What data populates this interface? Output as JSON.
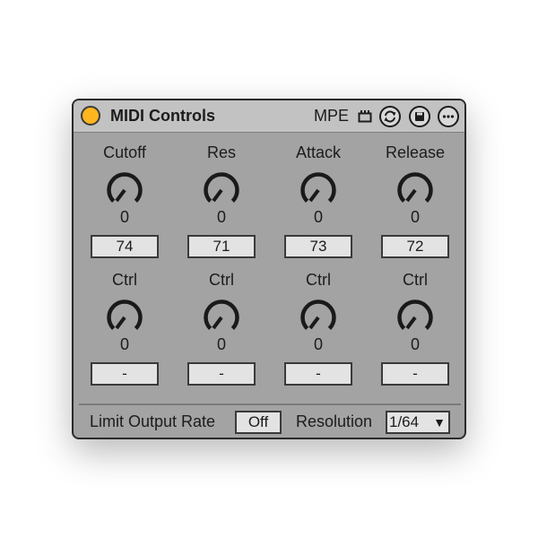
{
  "device": {
    "title": "MIDI Controls",
    "mpe_label": "MPE",
    "power_color": "#ffb51e",
    "icons": [
      "power-icon",
      "mpe-plug-icon",
      "sync-icon",
      "save-icon",
      "more-icon"
    ]
  },
  "controls": [
    {
      "label": "Cutoff",
      "value": "0",
      "cc": "74"
    },
    {
      "label": "Res",
      "value": "0",
      "cc": "71"
    },
    {
      "label": "Attack",
      "value": "0",
      "cc": "73"
    },
    {
      "label": "Release",
      "value": "0",
      "cc": "72"
    },
    {
      "label": "Ctrl",
      "value": "0",
      "cc": "-"
    },
    {
      "label": "Ctrl",
      "value": "0",
      "cc": "-"
    },
    {
      "label": "Ctrl",
      "value": "0",
      "cc": "-"
    },
    {
      "label": "Ctrl",
      "value": "0",
      "cc": "-"
    }
  ],
  "footer": {
    "limit_label": "Limit Output Rate",
    "limit_value": "Off",
    "resolution_label": "Resolution",
    "resolution_value": "1/64",
    "dropdown_arrow": "▼"
  }
}
